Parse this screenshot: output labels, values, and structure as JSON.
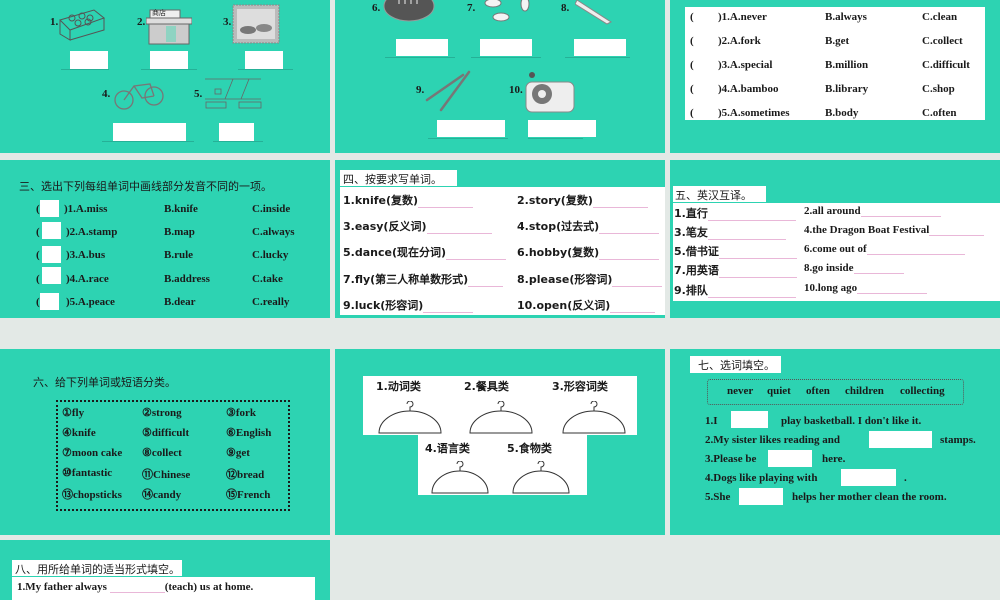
{
  "colors": {
    "slide_bg": "#2dd3b2",
    "page_bg": "#e3e9e6",
    "panel": "#ffffff",
    "blank_line": "#e9b7d8"
  },
  "slide1": {
    "labels": [
      "1.",
      "2.",
      "3.",
      "4.",
      "5."
    ],
    "shop_sign": "商店"
  },
  "slide2": {
    "labels": [
      "6.",
      "7.",
      "8.",
      "9.",
      "10."
    ]
  },
  "slide3": {
    "rows": [
      {
        "paren": "(",
        "num": ")1.A.never",
        "b": "B.always",
        "c": "C.clean"
      },
      {
        "paren": "(",
        "num": ")2.A.fork",
        "b": "B.get",
        "c": "C.collect"
      },
      {
        "paren": "(",
        "num": ")3.A.special",
        "b": "B.million",
        "c": "C.difficult"
      },
      {
        "paren": "(",
        "num": ")4.A.bamboo",
        "b": "B.library",
        "c": "C.shop"
      },
      {
        "paren": "(",
        "num": ")5.A.sometimes",
        "b": "B.body",
        "c": "C.often"
      }
    ]
  },
  "section3": {
    "title": "三、选出下列每组单词中画线部分发音不同的一项。",
    "rows": [
      {
        "paren": "(",
        "num": ")1.A.miss",
        "b": "B.knife",
        "c": "C.inside"
      },
      {
        "paren": "(",
        "num": ")2.A.stamp",
        "b": "B.map",
        "c": "C.always"
      },
      {
        "paren": "(",
        "num": ")3.A.bus",
        "b": "B.rule",
        "c": "C.lucky"
      },
      {
        "paren": "(",
        "num": ")4.A.race",
        "b": "B.address",
        "c": "C.take"
      },
      {
        "paren": "(",
        "num": ")5.A.peace",
        "b": "B.dear",
        "c": "C.really"
      }
    ]
  },
  "section4": {
    "title": "四、按要求写单词。",
    "items": [
      "1.knife(复数)",
      "2.story(复数)",
      "3.easy(反义词)",
      "4.stop(过去式)",
      "5.dance(现在分词)",
      "6.hobby(复数)",
      "7.fly(第三人称单数形式)",
      "8.please(形容词)",
      "9.luck(形容词)",
      "10.open(反义词)"
    ]
  },
  "section5": {
    "title": "五、英汉互译。",
    "items": [
      "1.直行",
      "2.all around",
      "3.笔友",
      "4.the Dragon Boat Festival",
      "5.借书证",
      "6.come out of",
      "7.用英语",
      "8.go inside",
      "9.排队",
      "10.long ago"
    ]
  },
  "section6": {
    "title": "六、给下列单词或短语分类。",
    "words": [
      "①fly",
      "②strong",
      "③fork",
      "④knife",
      "⑤difficult",
      "⑥English",
      "⑦moon cake",
      "⑧collect",
      "⑨get",
      "⑩fantastic",
      "⑪Chinese",
      "⑫bread",
      "⑬chopsticks",
      "⑭candy",
      "⑮French"
    ]
  },
  "section6b": {
    "categories": [
      "1.动词类",
      "2.餐具类",
      "3.形容词类",
      "4.语言类",
      "5.食物类"
    ]
  },
  "section7": {
    "title": "七、选词填空。",
    "word_bank": [
      "never",
      "quiet",
      "often",
      "children",
      "collecting"
    ],
    "sentences": [
      {
        "before": "1.I",
        "after": "play basketball. I don't like it."
      },
      {
        "before": "2.My sister likes reading and",
        "after": "stamps."
      },
      {
        "before": "3.Please be",
        "after": "here."
      },
      {
        "before": "4.Dogs like playing with",
        "after": "."
      },
      {
        "before": "5.She",
        "after": "helps her mother clean the room."
      }
    ]
  },
  "section8": {
    "title": "八、用所给单词的适当形式填空。",
    "sentence_before": "1.My father always",
    "sentence_after": "(teach) us at home."
  }
}
